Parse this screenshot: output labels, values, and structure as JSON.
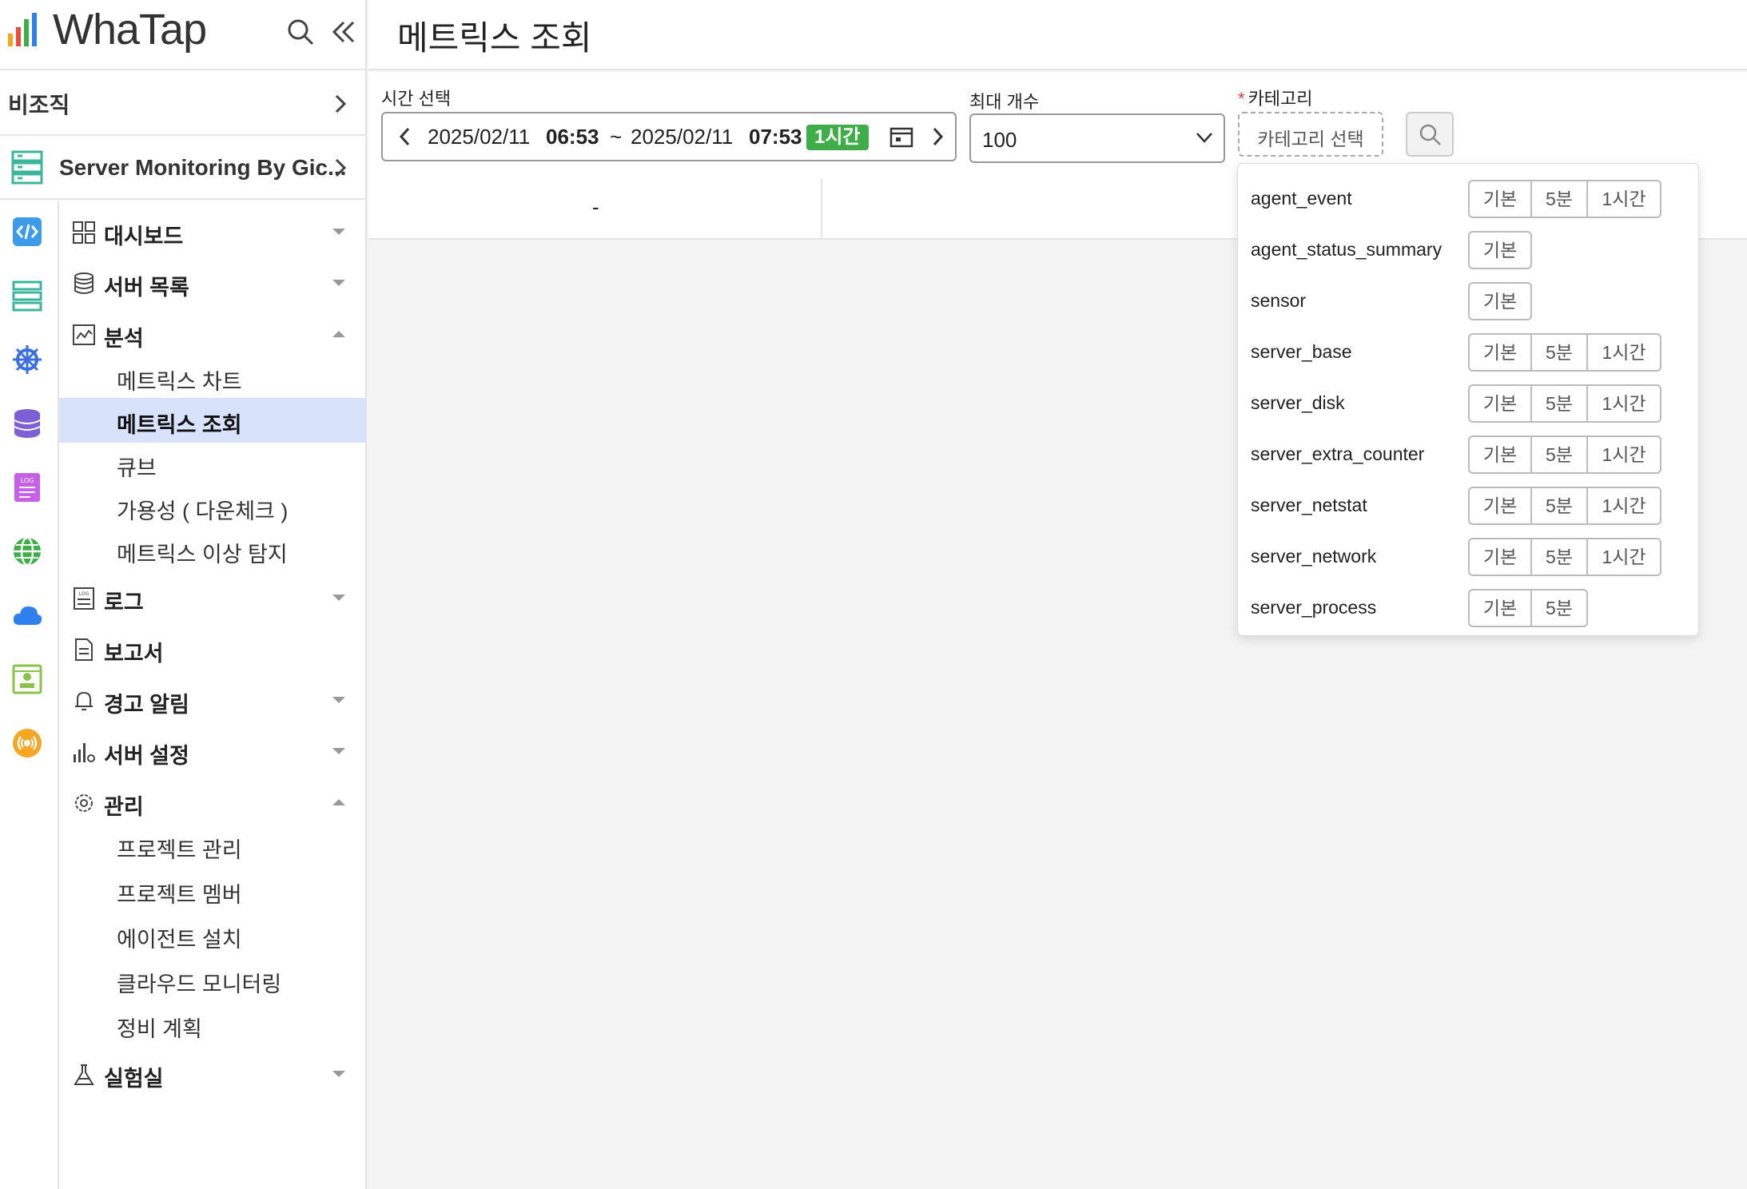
{
  "brand": {
    "name": "WhaTap"
  },
  "org": {
    "label": "비조직"
  },
  "project": {
    "label": "Server Monitoring By Gic..."
  },
  "menu": {
    "dashboard": "대시보드",
    "server_list": "서버 목록",
    "analysis": "분석",
    "analysis_items": [
      "메트릭스 차트",
      "메트릭스 조회",
      "큐브",
      "가용성 ( 다운체크 )",
      "메트릭스 이상 탐지"
    ],
    "log": "로그",
    "report": "보고서",
    "alert": "경고 알림",
    "server_settings": "서버 설정",
    "management": "관리",
    "management_items": [
      "프로젝트 관리",
      "프로젝트 멤버",
      "에이전트 설치",
      "클라우드 모니터링",
      "정비 계획"
    ],
    "lab": "실험실"
  },
  "page": {
    "title": "메트릭스 조회"
  },
  "filters": {
    "time_label": "시간 선택",
    "time_start_date": "2025/02/11",
    "time_start_time": "06:53",
    "time_sep": "~",
    "time_end_date": "2025/02/11",
    "time_end_time": "07:53",
    "duration": "1시간",
    "max_label": "최대 개수",
    "max_value": "100",
    "category_required": "*",
    "category_label": "카테고리",
    "category_button": "카테고리 선택"
  },
  "table": {
    "placeholder": "-"
  },
  "categories": [
    {
      "name": "agent_event",
      "options": [
        "기본",
        "5분",
        "1시간"
      ]
    },
    {
      "name": "agent_status_summary",
      "options": [
        "기본"
      ]
    },
    {
      "name": "sensor",
      "options": [
        "기본"
      ]
    },
    {
      "name": "server_base",
      "options": [
        "기본",
        "5분",
        "1시간"
      ]
    },
    {
      "name": "server_disk",
      "options": [
        "기본",
        "5분",
        "1시간"
      ]
    },
    {
      "name": "server_extra_counter",
      "options": [
        "기본",
        "5분",
        "1시간"
      ]
    },
    {
      "name": "server_netstat",
      "options": [
        "기본",
        "5분",
        "1시간"
      ]
    },
    {
      "name": "server_network",
      "options": [
        "기본",
        "5분",
        "1시간"
      ]
    },
    {
      "name": "server_process",
      "options": [
        "기본",
        "5분"
      ]
    }
  ],
  "colors": {
    "accent": "#3fae49",
    "active_bg": "#d8e2fb",
    "required": "#e53935"
  }
}
